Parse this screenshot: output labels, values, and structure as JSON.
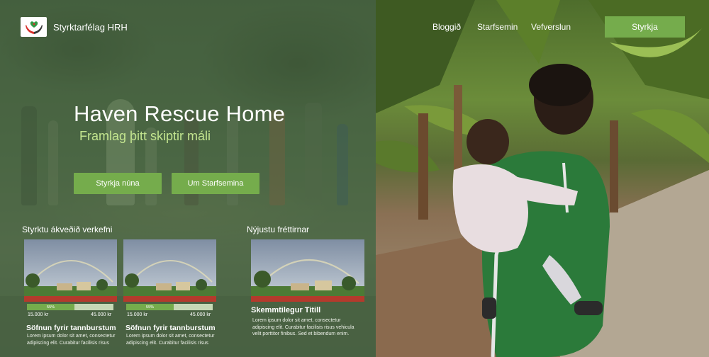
{
  "brand": {
    "name": "Styrktarfélag HRH"
  },
  "nav": {
    "links": [
      "Bloggið",
      "Starfsemin",
      "Vefverslun"
    ],
    "cta": "Styrkja"
  },
  "hero": {
    "title": "Haven Rescue Home",
    "subtitle": "Framlag þitt skiptir máli",
    "primary_button": "Styrkja núna",
    "secondary_button": "Um Starfsemina"
  },
  "projects": {
    "heading": "Styrktu ákveðið verkefni",
    "items": [
      {
        "progress": 55,
        "progress_label": "55%",
        "raised": "15.000 kr",
        "goal": "45.000 kr",
        "title": "Söfnun fyrir tannburstum",
        "text": "Lorem ipsum dolor sit amet, consectetur adipiscing elit. Curabitur facilisis risus"
      },
      {
        "progress": 55,
        "progress_label": "55%",
        "raised": "15.000 kr",
        "goal": "45.000 kr",
        "title": "Söfnun fyrir tannburstum",
        "text": "Lorem ipsum dolor sit amet, consectetur adipiscing elit. Curabitur facilisis risus"
      }
    ]
  },
  "news": {
    "heading": "Nýjustu fréttirnar",
    "title": "Skemmtilegur Titill",
    "text": "Lorem ipsum dolor sit amet, consectetur adipiscing elit. Curabitur facilisis risus vehicula velit porttitor finibus. Sed et bibendum enim."
  },
  "colors": {
    "accent": "#75ac4c",
    "subtitle": "#c3e58f",
    "overlay": "#486442"
  },
  "icons": {
    "logo": "hands-heart-logo-icon"
  }
}
